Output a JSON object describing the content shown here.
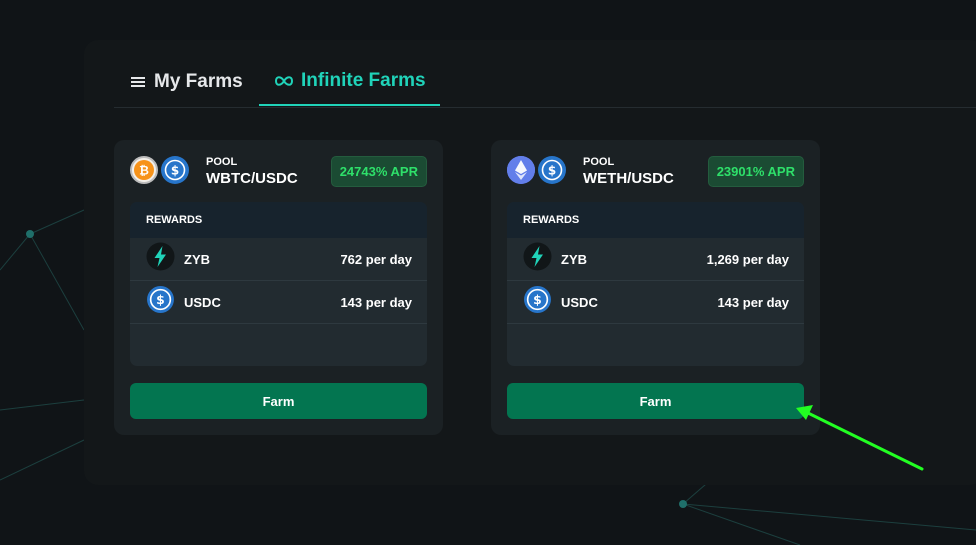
{
  "colors": {
    "background": "#101417",
    "accent": "#20d3b9",
    "apr_text": "#2ee06a",
    "farm_button": "#037550",
    "annotation_arrow": "#22ff22"
  },
  "tabs": [
    {
      "label": "My Farms",
      "icon": "list-icon",
      "active": false
    },
    {
      "label": "Infinite Farms",
      "icon": "infinity-icon",
      "active": true
    }
  ],
  "cards": [
    {
      "tokens": [
        "bitcoin-icon",
        "usdc-icon"
      ],
      "pool_label": "POOL",
      "pool_name": "WBTC/USDC",
      "apr": "24743% APR",
      "rewards_header": "REWARDS",
      "rewards": [
        {
          "icon": "zyb-bolt-icon",
          "token": "ZYB",
          "amount": "762 per day"
        },
        {
          "icon": "usdc-icon",
          "token": "USDC",
          "amount": "143 per day"
        }
      ],
      "button": "Farm"
    },
    {
      "tokens": [
        "ethereum-icon",
        "usdc-icon"
      ],
      "pool_label": "POOL",
      "pool_name": "WETH/USDC",
      "apr": "23901% APR",
      "rewards_header": "REWARDS",
      "rewards": [
        {
          "icon": "zyb-bolt-icon",
          "token": "ZYB",
          "amount": "1,269 per day"
        },
        {
          "icon": "usdc-icon",
          "token": "USDC",
          "amount": "143 per day"
        }
      ],
      "button": "Farm"
    }
  ]
}
